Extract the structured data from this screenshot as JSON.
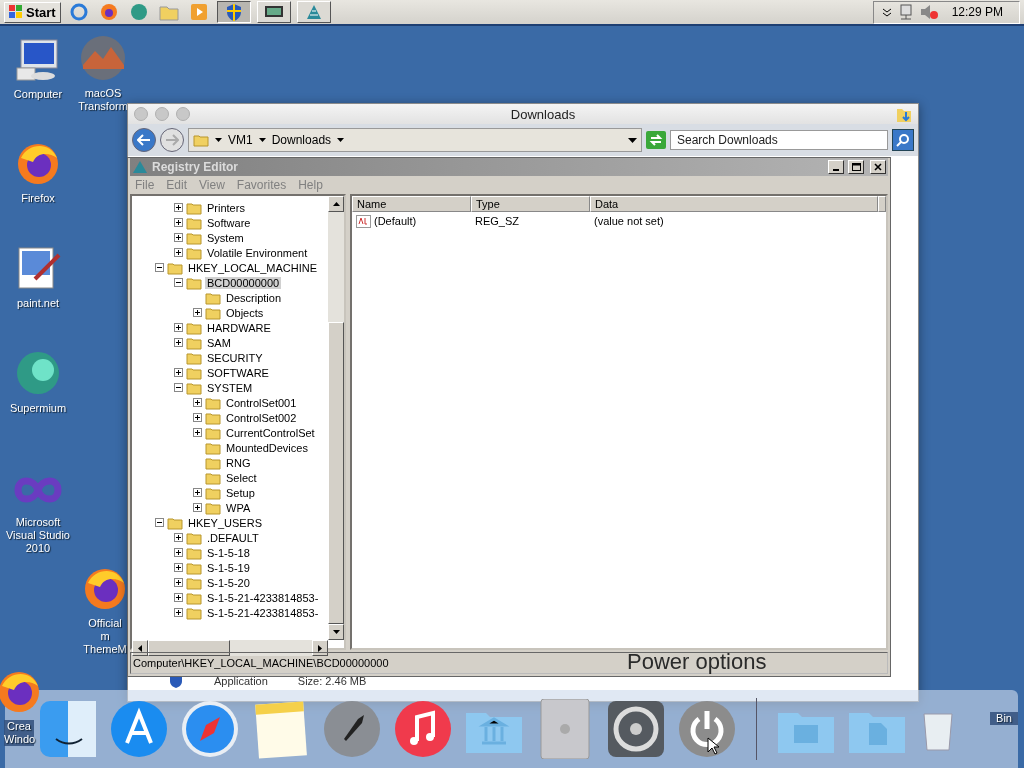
{
  "taskbar": {
    "start_label": "Start",
    "clock": "12:29 PM"
  },
  "desktop_icons": [
    {
      "label": "Computer"
    },
    {
      "label": "macOS Transform"
    },
    {
      "label": "Firefox"
    },
    {
      "label": "paint.net"
    },
    {
      "label": "Supermium"
    },
    {
      "label": "Microsoft Visual Studio 2010"
    },
    {
      "label": "Official m ThemeM"
    },
    {
      "label": "Crea Windo"
    },
    {
      "label": "Bin"
    }
  ],
  "explorer": {
    "title": "Downloads",
    "breadcrumb": [
      "VM1",
      "Downloads"
    ],
    "search": {
      "placeholder": "Search Downloads"
    },
    "file_row": {
      "type": "Application",
      "size": "Size: 2.46 MB"
    }
  },
  "registry": {
    "title": "Registry Editor",
    "menu": [
      "File",
      "Edit",
      "View",
      "Favorites",
      "Help"
    ],
    "tree": {
      "items_under_scrolled_parent": [
        {
          "label": "Printers",
          "expanded": false,
          "selected": false
        },
        {
          "label": "Software",
          "expanded": false,
          "selected": false
        },
        {
          "label": "System",
          "expanded": false,
          "selected": false
        },
        {
          "label": "Volatile Environment",
          "expanded": false,
          "selected": false
        }
      ],
      "roots": [
        {
          "label": "HKEY_LOCAL_MACHINE",
          "expanded": true,
          "selected": false,
          "children": [
            {
              "label": "BCD00000000",
              "expanded": true,
              "selected": true,
              "children": [
                {
                  "label": "Description",
                  "selected": false
                },
                {
                  "label": "Objects",
                  "expanded": false,
                  "selected": false
                }
              ]
            },
            {
              "label": "HARDWARE",
              "expanded": false,
              "selected": false
            },
            {
              "label": "SAM",
              "expanded": false,
              "selected": false
            },
            {
              "label": "SECURITY",
              "selected": false
            },
            {
              "label": "SOFTWARE",
              "expanded": false,
              "selected": false
            },
            {
              "label": "SYSTEM",
              "expanded": true,
              "selected": false,
              "children": [
                {
                  "label": "ControlSet001",
                  "expanded": false,
                  "selected": false
                },
                {
                  "label": "ControlSet002",
                  "expanded": false,
                  "selected": false
                },
                {
                  "label": "CurrentControlSet",
                  "expanded": false,
                  "selected": false
                },
                {
                  "label": "MountedDevices",
                  "selected": false
                },
                {
                  "label": "RNG",
                  "selected": false
                },
                {
                  "label": "Select",
                  "selected": false
                },
                {
                  "label": "Setup",
                  "expanded": false,
                  "selected": false
                },
                {
                  "label": "WPA",
                  "expanded": false,
                  "selected": false
                }
              ]
            }
          ]
        },
        {
          "label": "HKEY_USERS",
          "expanded": true,
          "selected": false,
          "children": [
            {
              "label": ".DEFAULT",
              "expanded": false,
              "selected": false
            },
            {
              "label": "S-1-5-18",
              "expanded": false,
              "selected": false
            },
            {
              "label": "S-1-5-19",
              "expanded": false,
              "selected": false
            },
            {
              "label": "S-1-5-20",
              "expanded": false,
              "selected": false
            },
            {
              "label": "S-1-5-21-4233814853-",
              "expanded": false,
              "selected": false
            },
            {
              "label": "S-1-5-21-4233814853-",
              "expanded": false,
              "selected": false
            }
          ]
        }
      ]
    },
    "columns": [
      "Name",
      "Type",
      "Data"
    ],
    "values": [
      {
        "name": "(Default)",
        "type": "REG_SZ",
        "data": "(value not set)"
      }
    ],
    "status": "Computer\\HKEY_LOCAL_MACHINE\\BCD00000000"
  },
  "tooltip": "Power options"
}
